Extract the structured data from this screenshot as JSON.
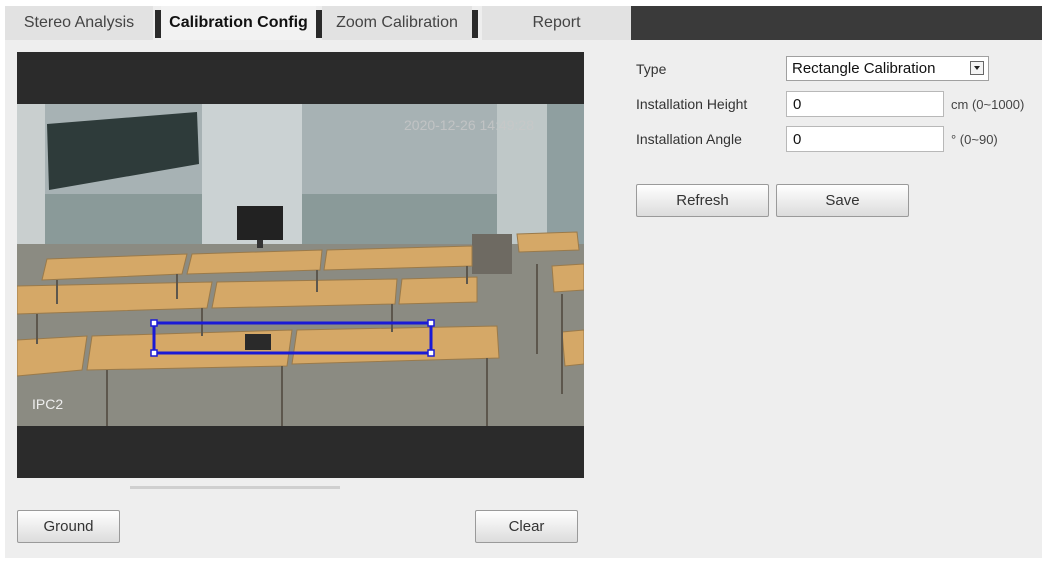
{
  "tabs": [
    {
      "label": "Stereo Analysis",
      "active": false
    },
    {
      "label": "Calibration Config",
      "active": true
    },
    {
      "label": "Zoom Calibration",
      "active": false
    },
    {
      "label": "Report",
      "active": false
    }
  ],
  "video": {
    "timestamp": "2020-12-26 14:49:28",
    "channel": "IPC2"
  },
  "form": {
    "type_label": "Type",
    "type_value": "Rectangle Calibration",
    "height_label": "Installation Height",
    "height_value": "0",
    "height_unit": "cm (0~1000)",
    "angle_label": "Installation Angle",
    "angle_value": "0",
    "angle_unit": "° (0~90)"
  },
  "buttons": {
    "refresh": "Refresh",
    "save": "Save",
    "ground": "Ground",
    "clear": "Clear"
  },
  "colors": {
    "calibration_box": "#1a1ad6",
    "tab_bar_dark": "#3a3a3a"
  }
}
